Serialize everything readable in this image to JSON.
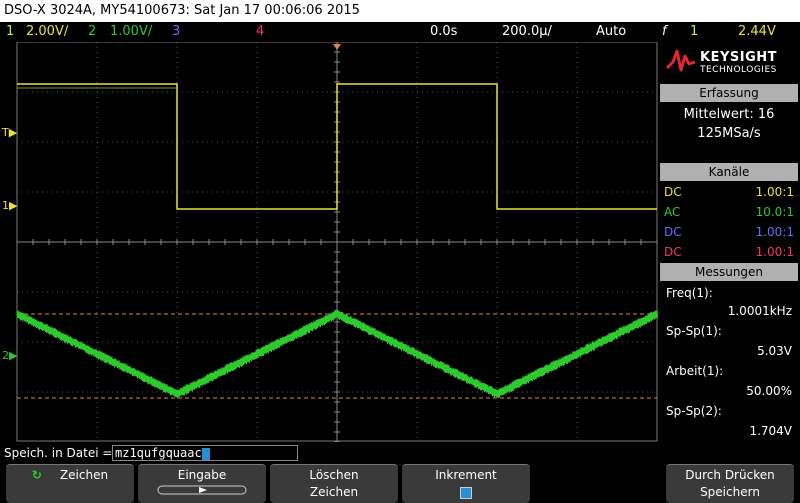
{
  "title": "DSO-X 3024A, MY54100673: Sat Jan 17 00:06:06 2015",
  "channel_bar": {
    "ch1_num": "1",
    "ch1_scale": "2.00V/",
    "ch2_num": "2",
    "ch2_scale": "1.00V/",
    "ch3_num": "3",
    "ch4_num": "4",
    "time_delay": "0.0s",
    "time_scale": "200.0µ/",
    "trigger_mode": "Auto",
    "trigger_icon": "f",
    "trigger_source": "1",
    "trigger_level": "2.44V"
  },
  "colors": {
    "ch1": "#e8e23a",
    "ch2": "#2ec92e",
    "ch3": "#6b6bff",
    "ch4": "#ff3070",
    "cursor_line": "#e2863a"
  },
  "logo": {
    "brand": "KEYSIGHT",
    "sub": "TECHNOLOGIES"
  },
  "acquisition": {
    "header": "Erfassung",
    "mode": "Mittelwert: 16",
    "rate": "125MSa/s"
  },
  "channels": {
    "header": "Kanäle",
    "rows": [
      {
        "coupling": "DC",
        "probe": "1.00:1"
      },
      {
        "coupling": "AC",
        "probe": "10.0:1"
      },
      {
        "coupling": "DC",
        "probe": "1.00:1"
      },
      {
        "coupling": "DC",
        "probe": "1.00:1"
      }
    ]
  },
  "measurements": {
    "header": "Messungen",
    "items": [
      {
        "label": "Freq(1):",
        "value": "1.0001kHz"
      },
      {
        "label": "Sp-Sp(1):",
        "value": "5.03V"
      },
      {
        "label": "Arbeit(1):",
        "value": "50.00%"
      },
      {
        "label": "Sp-Sp(2):",
        "value": "1.704V"
      }
    ]
  },
  "file": {
    "label": "Speich. in Datei =",
    "value": "mz1qufgquaac"
  },
  "markers": {
    "trigger_level": "T",
    "ch1": "1",
    "ch2": "2"
  },
  "softkeys": {
    "k1": {
      "l1": "Zeichen",
      "l2": ""
    },
    "k2": {
      "l1": "Eingabe",
      "l2": ""
    },
    "k3": {
      "l1": "Löschen",
      "l2": "Zeichen"
    },
    "k4": {
      "l1": "Inkrement",
      "l2": ""
    },
    "k5": {
      "l1": "Durch Drücken",
      "l2": "Speichern"
    }
  }
}
